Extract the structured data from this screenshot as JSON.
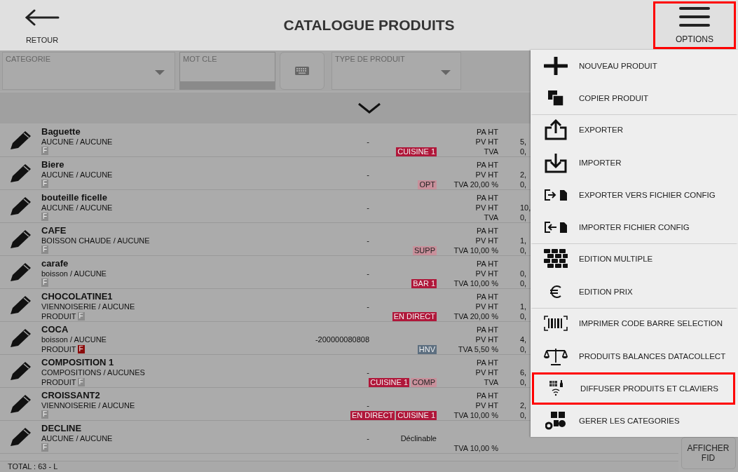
{
  "header": {
    "back": {
      "label": "RETOUR"
    },
    "title": "CATALOGUE PRODUITS",
    "options": {
      "label": "OPTIONS",
      "highlighted": true
    }
  },
  "filters": {
    "category": {
      "label": "CATEGORIE"
    },
    "keyword": {
      "label": "MOT CLE"
    },
    "product_type": {
      "label": "TYPE DE PRODUIT"
    }
  },
  "products": [
    {
      "name": "Baguette",
      "category": "AUCUNE / AUCUNE",
      "code": "-",
      "badge": {
        "text": "F",
        "color": "#8c8c8c"
      },
      "tags": [
        {
          "text": "CUISINE 1",
          "color": "#b0173a"
        }
      ],
      "pa": {
        "label": "PA HT"
      },
      "pv": {
        "label": "PV HT",
        "value": "5,"
      },
      "tva": {
        "label": "TVA",
        "value": "0,"
      }
    },
    {
      "name": "Biere",
      "category": "AUCUNE / AUCUNE",
      "code": "-",
      "badge": {
        "text": "F",
        "color": "#8c8c8c"
      },
      "tags": [
        {
          "text": "OPT",
          "color": "#c8909b"
        }
      ],
      "pa": {
        "label": "PA HT"
      },
      "pv": {
        "label": "PV HT",
        "value": "2,"
      },
      "tva": {
        "label": "TVA 20,00 %",
        "value": "0,"
      }
    },
    {
      "name": "bouteille ficelle",
      "category": "AUCUNE / AUCUNE",
      "code": "-",
      "badge": {
        "text": "F",
        "color": "#8c8c8c"
      },
      "pa": {
        "label": "PA HT"
      },
      "pv": {
        "label": "PV HT",
        "value": "10,"
      },
      "tva": {
        "label": "TVA",
        "value": "0,"
      }
    },
    {
      "name": "CAFE",
      "category": "BOISSON CHAUDE / AUCUNE",
      "code": "-",
      "badge": {
        "text": "F",
        "color": "#8c8c8c"
      },
      "tags": [
        {
          "text": "SUPP",
          "color": "#c8909b"
        }
      ],
      "pa": {
        "label": "PA HT"
      },
      "pv": {
        "label": "PV HT",
        "value": "1,"
      },
      "tva": {
        "label": "TVA 10,00 %",
        "value": "0,"
      }
    },
    {
      "name": "carafe",
      "category": "boisson / AUCUNE",
      "code": "-",
      "badge": {
        "text": "F",
        "color": "#8c8c8c"
      },
      "tags": [
        {
          "text": "BAR 1",
          "color": "#b0173a"
        }
      ],
      "pa": {
        "label": "PA HT"
      },
      "pv": {
        "label": "PV HT",
        "value": "0,"
      },
      "tva": {
        "label": "TVA 10,00 %",
        "value": "0,"
      }
    },
    {
      "name": "CHOCOLATINE1",
      "category": "VIENNOISERIE / AUCUNE",
      "code": "-",
      "type": "PRODUIT",
      "badge": {
        "text": "F",
        "color": "#8c8c8c"
      },
      "tags": [
        {
          "text": "EN DIRECT",
          "color": "#b0173a"
        }
      ],
      "pa": {
        "label": "PA HT"
      },
      "pv": {
        "label": "PV HT",
        "value": "1,"
      },
      "tva": {
        "label": "TVA 20,00 %",
        "value": "0,"
      }
    },
    {
      "name": "COCA",
      "category": "boisson / AUCUNE",
      "code": "-200000080808",
      "type": "PRODUIT",
      "badge": {
        "text": "F",
        "color": "#8b0b0b"
      },
      "tags": [
        {
          "text": "HNV",
          "color": "#5d6f80"
        }
      ],
      "pa": {
        "label": "PA HT"
      },
      "pv": {
        "label": "PV HT",
        "value": "4,"
      },
      "tva": {
        "label": "TVA 5,50 %",
        "value": "0,"
      }
    },
    {
      "name": "COMPOSITION 1",
      "category": "COMPOSITIONS / AUCUNES",
      "code": "-",
      "type": "PRODUIT",
      "badge": {
        "text": "F",
        "color": "#8c8c8c"
      },
      "tags": [
        {
          "text": "CUISINE 1",
          "color": "#b0173a"
        },
        {
          "text": "COMP",
          "color": "#c8909b"
        }
      ],
      "pa": {
        "label": "PA HT"
      },
      "pv": {
        "label": "PV HT",
        "value": "6,"
      },
      "tva": {
        "label": "TVA",
        "value": "0,"
      }
    },
    {
      "name": "CROISSANT2",
      "category": "VIENNOISERIE / AUCUNE",
      "code": "-",
      "badge": {
        "text": "F",
        "color": "#8c8c8c"
      },
      "tags": [
        {
          "text": "EN DIRECT",
          "color": "#b0173a"
        },
        {
          "text": "CUISINE 1",
          "color": "#b0173a"
        }
      ],
      "pa": {
        "label": "PA HT"
      },
      "pv": {
        "label": "PV HT",
        "value": "2,"
      },
      "tva": {
        "label": "TVA 10,00 %",
        "value": "0,"
      }
    },
    {
      "name": "DECLINE",
      "category": "AUCUNE / AUCUNE",
      "code": "-",
      "note": "Déclinable",
      "badge": {
        "text": "F",
        "color": "#8c8c8c"
      },
      "tva": {
        "label": "TVA 10,00 %"
      }
    }
  ],
  "status_bar": {
    "total": "TOTAL : 63  - L"
  },
  "side_button": {
    "label": "AFFICHER FID"
  },
  "menu": {
    "groups": [
      [
        {
          "label": "NOUVEAU PRODUIT",
          "highlighted": false
        },
        {
          "label": "COPIER PRODUIT",
          "highlighted": false
        }
      ],
      [
        {
          "label": "EXPORTER",
          "highlighted": false
        },
        {
          "label": "IMPORTER",
          "highlighted": false
        },
        {
          "label": "EXPORTER VERS FICHIER CONFIG",
          "highlighted": false
        },
        {
          "label": "IMPORTER FICHIER CONFIG",
          "highlighted": false
        }
      ],
      [
        {
          "label": "EDITION MULTIPLE",
          "highlighted": false
        },
        {
          "label": "EDITION PRIX",
          "highlighted": false
        }
      ],
      [
        {
          "label": "IMPRIMER CODE BARRE SELECTION",
          "highlighted": false
        },
        {
          "label": "PRODUITS BALANCES DATACOLLECT",
          "highlighted": false
        },
        {
          "label": "DIFFUSER PRODUITS ET CLAVIERS",
          "highlighted": true
        },
        {
          "label": "GERER LES CATEGORIES",
          "highlighted": false
        }
      ]
    ]
  }
}
